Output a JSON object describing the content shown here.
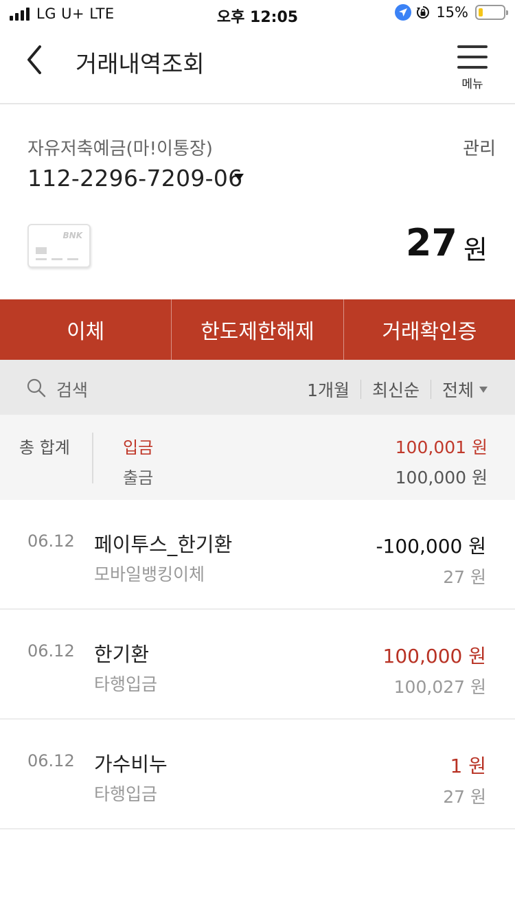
{
  "status_bar": {
    "carrier": "LG U+  LTE",
    "time": "오후 12:05",
    "battery_percent": "15%",
    "battery_level": 0.15,
    "icons": [
      "signal-icon",
      "location-icon",
      "rotation-lock-icon",
      "battery-icon"
    ]
  },
  "header": {
    "title": "거래내역조회",
    "menu_label": "메뉴",
    "icons": [
      "back-icon",
      "menu-icon"
    ]
  },
  "account": {
    "type": "자유저축예금(마!이통장)",
    "number": "112-2296-7209-06",
    "manage_label": "관리",
    "card_brand": "BNK",
    "balance": "27",
    "balance_unit": "원"
  },
  "actions": {
    "transfer": "이체",
    "limit_release": "한도제한해제",
    "certificate": "거래확인증"
  },
  "filter": {
    "search_label": "검색",
    "period": "1개월",
    "sort": "최신순",
    "category": "전체"
  },
  "totals": {
    "label": "총 합계",
    "deposit_label": "입금",
    "deposit_amount": "100,001 원",
    "withdraw_label": "출금",
    "withdraw_amount": "100,000 원"
  },
  "transactions": [
    {
      "date": "06.12",
      "name": "페이투스_한기환",
      "type": "모바일뱅킹이체",
      "amount": "-100,000 원",
      "balance": "27 원",
      "kind": "withdraw"
    },
    {
      "date": "06.12",
      "name": "한기환",
      "type": "타행입금",
      "amount": "100,000 원",
      "balance": "100,027 원",
      "kind": "deposit"
    },
    {
      "date": "06.12",
      "name": "가수비누",
      "type": "타행입금",
      "amount": "1 원",
      "balance": "27 원",
      "kind": "deposit"
    }
  ],
  "colors": {
    "accent": "#bb3b25",
    "deposit_text": "#c0392b",
    "filter_bg": "#e9e9e9",
    "totals_bg": "#f5f5f5"
  }
}
